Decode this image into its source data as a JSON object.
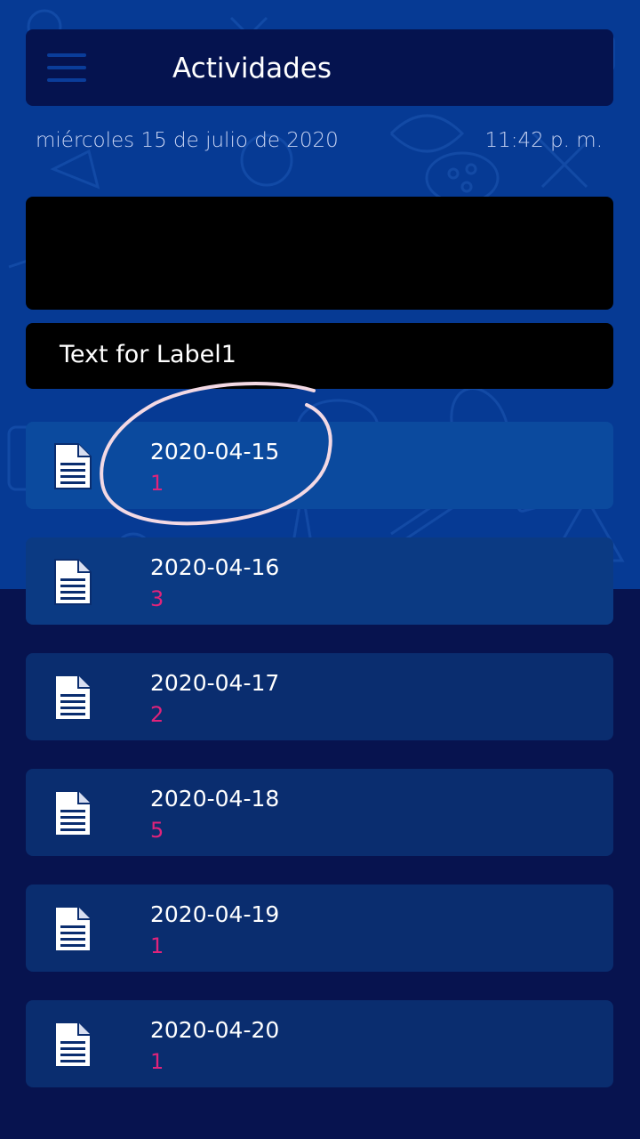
{
  "header": {
    "title": "Actividades"
  },
  "subheader": {
    "date": "miércoles 15 de julio de 2020",
    "time": "11:42 p. m."
  },
  "label_panel": {
    "text": "Text for Label1"
  },
  "activities": [
    {
      "date": "2020-04-15",
      "count": "1"
    },
    {
      "date": "2020-04-16",
      "count": "3"
    },
    {
      "date": "2020-04-17",
      "count": "2"
    },
    {
      "date": "2020-04-18",
      "count": "5"
    },
    {
      "date": "2020-04-19",
      "count": "1"
    },
    {
      "date": "2020-04-20",
      "count": "1"
    }
  ],
  "colors": {
    "background_top": "#063a94",
    "background_bottom": "#07134f",
    "card": "#0a2d6f",
    "count_accent": "#e0237a",
    "annotation_stroke": "#f3d9e4"
  },
  "icons": {
    "menu": "hamburger-menu-icon",
    "list_item": "document-icon"
  }
}
